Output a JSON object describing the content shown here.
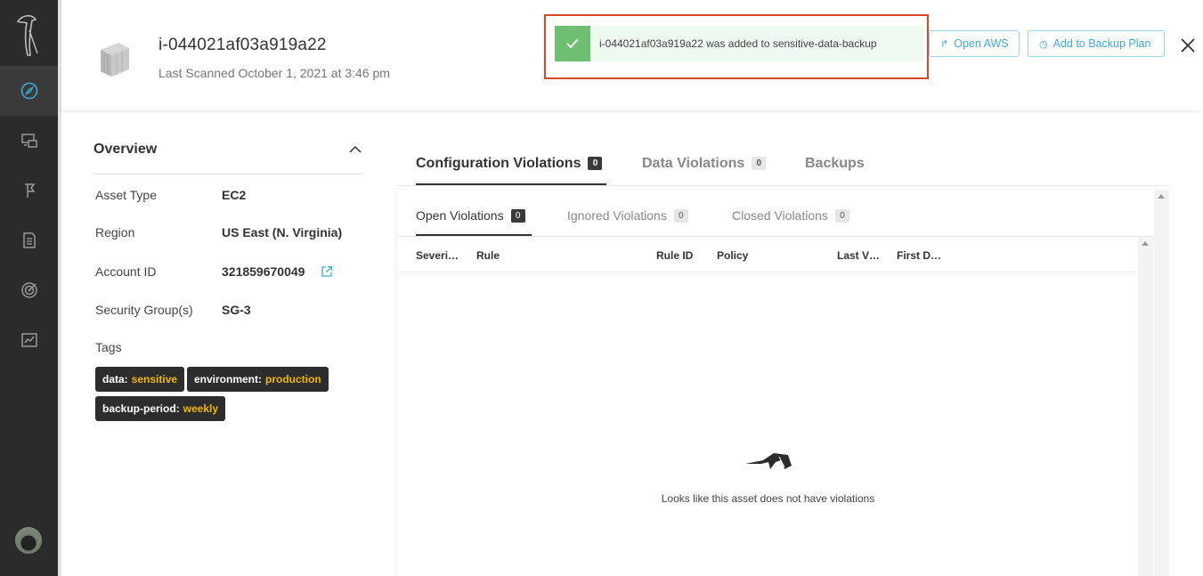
{
  "header": {
    "asset_id": "i-044021af03a919a22",
    "last_scanned": "Last Scanned October 1, 2021 at 3:46 pm",
    "open_aws_label": "Open AWS",
    "add_backup_label": "Add to Backup Plan"
  },
  "toast": {
    "message": "i-044021af03a919a22 was added to sensitive-data-backup"
  },
  "sidebar": {
    "items": [
      {
        "icon": "compass-icon",
        "active": true
      },
      {
        "icon": "assets-icon",
        "active": false
      },
      {
        "icon": "flag-icon",
        "active": false
      },
      {
        "icon": "document-icon",
        "active": false
      },
      {
        "icon": "target-icon",
        "active": false
      },
      {
        "icon": "chart-icon",
        "active": false
      }
    ]
  },
  "overview": {
    "title": "Overview",
    "fields": [
      {
        "label": "Asset Type",
        "value": "EC2"
      },
      {
        "label": "Region",
        "value": "US East (N. Virginia)"
      },
      {
        "label": "Account ID",
        "value": "321859670049"
      },
      {
        "label": "Security Group(s)",
        "value": "SG-3"
      }
    ],
    "tags_label": "Tags",
    "tags": [
      {
        "key": "data:",
        "value": "sensitive"
      },
      {
        "key": "environment:",
        "value": "production"
      },
      {
        "key": "backup-period:",
        "value": "weekly"
      }
    ]
  },
  "tabs": [
    {
      "label": "Configuration Violations",
      "count": "0"
    },
    {
      "label": "Data Violations",
      "count": "0"
    },
    {
      "label": "Backups"
    }
  ],
  "subtabs": [
    {
      "label": "Open Violations",
      "count": "0"
    },
    {
      "label": "Ignored Violations",
      "count": "0"
    },
    {
      "label": "Closed Violations",
      "count": "0"
    }
  ],
  "table": {
    "columns": [
      "Severi…",
      "Rule",
      "Rule ID",
      "Policy",
      "Last V…",
      "First D…"
    ],
    "empty_message": "Looks like this asset does not have violations"
  },
  "colors": {
    "accent": "#3fa9d6",
    "toast_green": "#6fbf73",
    "highlight_frame": "#d8492c",
    "tag_value": "#f2b705"
  }
}
